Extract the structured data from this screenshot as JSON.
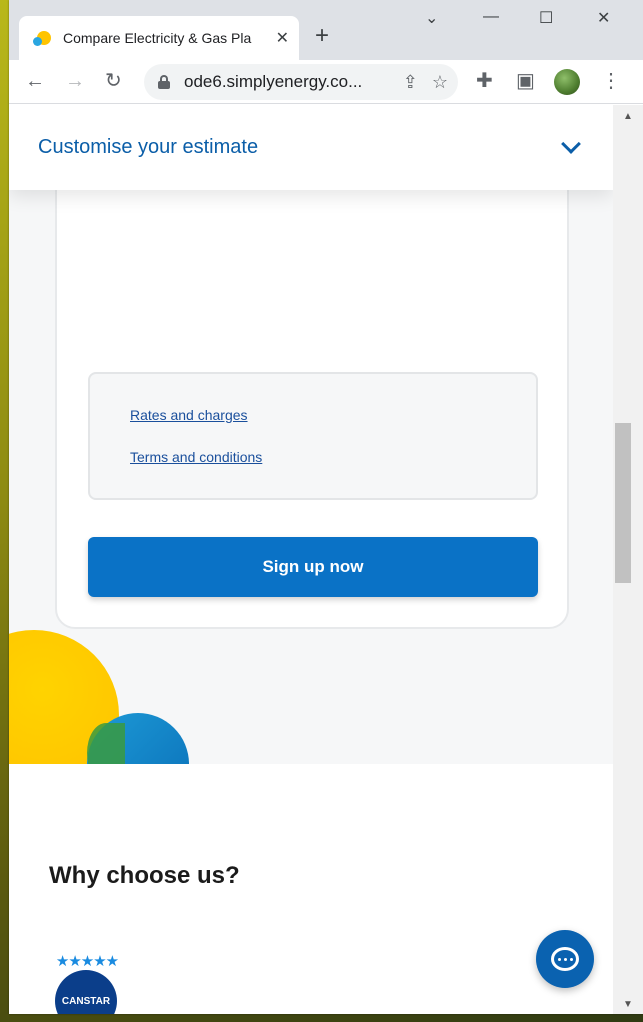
{
  "browser": {
    "tab_title": "Compare Electricity & Gas Pla",
    "url": "ode6.simplyenergy.co...",
    "new_tab": "+",
    "close_tab": "✕",
    "window_minimize": "—",
    "window_maximize": "☐",
    "window_close": "✕",
    "collapse": "⌄"
  },
  "sticky": {
    "title": "Customise your estimate"
  },
  "card": {
    "links": [
      "Rates and charges",
      "Terms and conditions"
    ],
    "signup_label": "Sign up now"
  },
  "section": {
    "heading": "Why choose us?"
  },
  "canstar": {
    "stars": "★★★★★",
    "label": "CANSTAR"
  },
  "colors": {
    "brand_blue": "#0a72c6",
    "link_blue": "#1a4f9c",
    "yellow": "#ffc800"
  }
}
